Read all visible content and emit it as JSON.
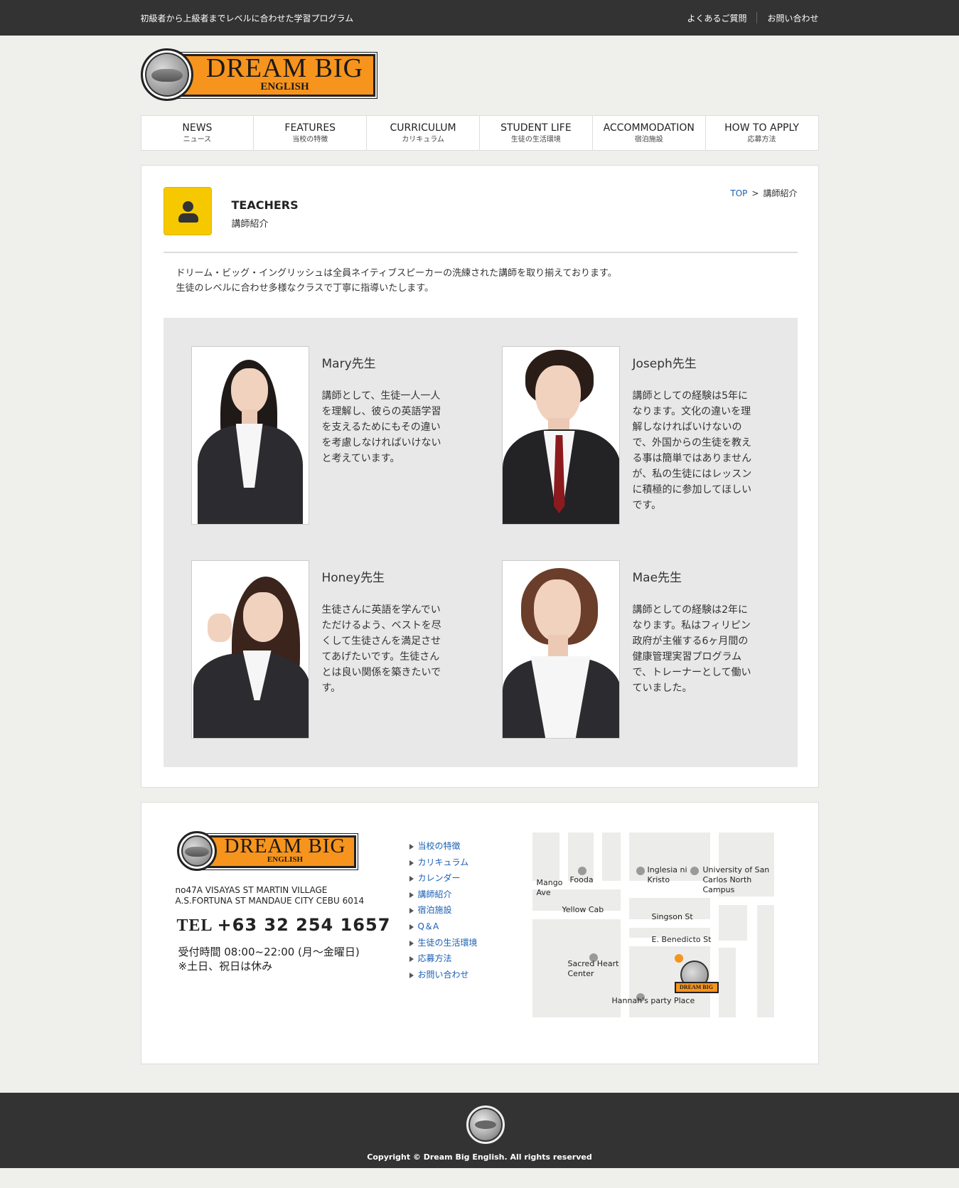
{
  "topbar": {
    "tagline": "初級者から上級者までレベルに合わせた学習プログラム",
    "links": [
      "よくあるご質問",
      "お問い合わせ"
    ]
  },
  "logo": {
    "name": "DREAM BIG",
    "sub": "ENGLISH"
  },
  "nav": [
    {
      "en": "NEWS",
      "jp": "ニュース"
    },
    {
      "en": "FEATURES",
      "jp": "当校の特徴"
    },
    {
      "en": "CURRICULUM",
      "jp": "カリキュラム"
    },
    {
      "en": "STUDENT LIFE",
      "jp": "生徒の生活環境"
    },
    {
      "en": "ACCOMMODATION",
      "jp": "宿泊施設"
    },
    {
      "en": "HOW TO APPLY",
      "jp": "応募方法"
    }
  ],
  "page": {
    "title": "TEACHERS",
    "title_jp": "講師紹介",
    "breadcrumb_top": "TOP",
    "breadcrumb_sep": ">",
    "breadcrumb_current": "講師紹介",
    "intro": [
      "ドリーム・ビッグ・イングリッシュは全員ネイティブスピーカーの洗練された講師を取り揃えております。",
      "生徒のレベルに合わせ多様なクラスで丁寧に指導いたします。"
    ]
  },
  "teachers": [
    {
      "name": "Mary先生",
      "desc": [
        "講師として、生徒一人一人",
        "を理解し、彼らの英語学習",
        "を支えるためにもその違い",
        "を考慮しなければいけない",
        "と考えています。"
      ]
    },
    {
      "name": "Joseph先生",
      "desc": [
        "講師としての経験は5年に",
        "なります。文化の違いを理",
        "解しなければいけないの",
        "で、外国からの生徒を教え",
        "る事は簡単ではありません",
        "が、私の生徒にはレッスン",
        "に積極的に参加してほしい",
        "です。"
      ]
    },
    {
      "name": "Honey先生",
      "desc": [
        "生徒さんに英語を学んでい",
        "ただけるよう、ベストを尽",
        "くして生徒さんを満足させ",
        "てあげたいです。生徒さん",
        "とは良い関係を築きたいで",
        "す。"
      ]
    },
    {
      "name": "Mae先生",
      "desc": [
        "講師としての経験は2年に",
        "なります。私はフィリピン",
        "政府が主催する6ヶ月間の",
        "健康管理実習プログラム",
        "で、トレーナーとして働い",
        "ていました。"
      ]
    }
  ],
  "footer": {
    "address": [
      "no47A VISAYAS ST MARTIN VILLAGE",
      "A.S.FORTUNA ST MANDAUE CITY CEBU 6014"
    ],
    "tel_label": "TEL",
    "tel": "+63 32 254 1657",
    "hours": [
      "受付時間 08:00~22:00 (月～金曜日)",
      "※土日、祝日は休み"
    ],
    "links": [
      "当校の特徴",
      "カリキュラム",
      "カレンダー",
      "講師紹介",
      "宿泊施設",
      "Q＆A",
      "生徒の生活環境",
      "応募方法",
      "お問い合わせ"
    ],
    "map": {
      "labels": [
        "Mango Ave",
        "Fooda",
        "Inglesia ni Kristo",
        "University of San Carlos North Campus",
        "Yellow Cab",
        "Singson St",
        "E. Benedicto St",
        "Sacred Heart Center",
        "Hannah's party Place"
      ],
      "logo_text": "DREAM BIG"
    },
    "copyright": "Copyright © Dream Big English. All rights reserved"
  },
  "colors": {
    "accent": "#f7941d",
    "icon_bg": "#f5c800",
    "link": "#1a5fb4",
    "dark": "#333333"
  }
}
